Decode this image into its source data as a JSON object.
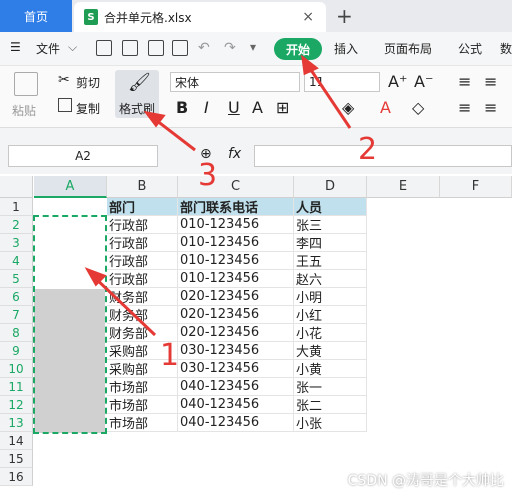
{
  "tabs": {
    "home": "首页",
    "file": "合并单元格.xlsx",
    "new_tab": "+",
    "close": "×"
  },
  "menu": {
    "file": "文件",
    "start": "开始",
    "insert": "插入",
    "page_layout": "页面布局",
    "formula": "公式",
    "more": "数"
  },
  "ribbon": {
    "paste": "粘贴",
    "cut": "剪切",
    "copy": "复制",
    "format_painter": "格式刷",
    "font_name": "宋体",
    "font_size": "11"
  },
  "formula_bar": {
    "cell_ref": "A2",
    "fx": "fx",
    "zoom_icon": "magnifier-icon"
  },
  "columns": [
    "A",
    "B",
    "C",
    "D",
    "E",
    "F"
  ],
  "rows": [
    "1",
    "2",
    "3",
    "4",
    "5",
    "6",
    "7",
    "8",
    "9",
    "10",
    "11",
    "12",
    "13",
    "14",
    "15",
    "16"
  ],
  "table": {
    "headers": {
      "dept": "部门",
      "phone": "部门联系电话",
      "person": "人员"
    },
    "rows": [
      {
        "dept": "行政部",
        "phone": "010-123456",
        "person": "张三"
      },
      {
        "dept": "行政部",
        "phone": "010-123456",
        "person": "李四"
      },
      {
        "dept": "行政部",
        "phone": "010-123456",
        "person": "王五"
      },
      {
        "dept": "行政部",
        "phone": "010-123456",
        "person": "赵六"
      },
      {
        "dept": "财务部",
        "phone": "020-123456",
        "person": "小明"
      },
      {
        "dept": "财务部",
        "phone": "020-123456",
        "person": "小红"
      },
      {
        "dept": "财务部",
        "phone": "020-123456",
        "person": "小花"
      },
      {
        "dept": "采购部",
        "phone": "030-123456",
        "person": "大黄"
      },
      {
        "dept": "采购部",
        "phone": "030-123456",
        "person": "小黄"
      },
      {
        "dept": "市场部",
        "phone": "040-123456",
        "person": "张一"
      },
      {
        "dept": "市场部",
        "phone": "040-123456",
        "person": "张二"
      },
      {
        "dept": "市场部",
        "phone": "040-123456",
        "person": "小张"
      }
    ]
  },
  "annotations": {
    "step1": "1",
    "step2": "2",
    "step3": "3"
  },
  "watermark": "CSDN @涛哥是个大帅比",
  "colors": {
    "start_green": "#1aa864",
    "header_fill": "#bfe0ec",
    "selection": "#d0d0d0",
    "annotation_red": "#e53935",
    "home_blue": "#2f7ee8"
  }
}
